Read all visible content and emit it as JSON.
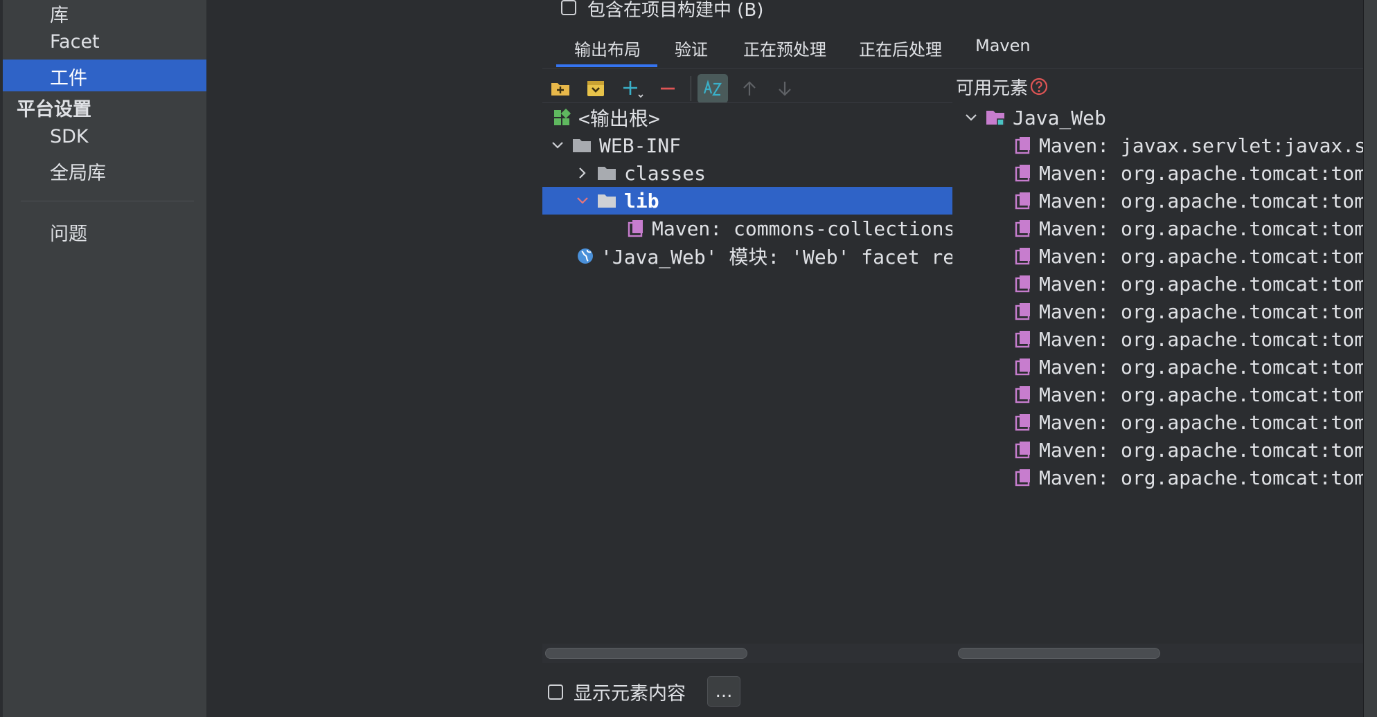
{
  "sidebar": {
    "items": [
      {
        "label": "库"
      },
      {
        "label": "Facet"
      },
      {
        "label": "工件",
        "selected": true
      }
    ],
    "platform_heading": "平台设置",
    "platform_items": [
      {
        "label": "SDK"
      },
      {
        "label": "全局库"
      }
    ],
    "problems": "问题"
  },
  "include_build_checkbox": {
    "label": "包含在项目构建中 (B)",
    "checked": false
  },
  "tabs": [
    {
      "label": "输出布局",
      "active": true
    },
    {
      "label": "验证"
    },
    {
      "label": "正在预处理"
    },
    {
      "label": "正在后处理"
    },
    {
      "label": "Maven"
    }
  ],
  "toolbar": {
    "icons": [
      "create-directory-icon",
      "create-archive-icon",
      "add-icon",
      "remove-icon",
      "sort-alphabetically-icon",
      "move-up-icon",
      "move-down-icon"
    ]
  },
  "output_tree": {
    "root": "<输出根>",
    "web_inf": "WEB-INF",
    "classes": "classes",
    "lib": "lib",
    "lib_child": "Maven: commons-collections",
    "facet_resource": "'Java_Web' 模块: 'Web' facet re"
  },
  "available": {
    "title": "可用元素",
    "module": "Java_Web",
    "items": [
      "Maven: javax.servlet:javax.s",
      "Maven: org.apache.tomcat:tom",
      "Maven: org.apache.tomcat:tom",
      "Maven: org.apache.tomcat:tom",
      "Maven: org.apache.tomcat:tom",
      "Maven: org.apache.tomcat:tom",
      "Maven: org.apache.tomcat:tom",
      "Maven: org.apache.tomcat:tom",
      "Maven: org.apache.tomcat:tom",
      "Maven: org.apache.tomcat:tom",
      "Maven: org.apache.tomcat:tom",
      "Maven: org.apache.tomcat:tom",
      "Maven: org.apache.tomcat:tom"
    ]
  },
  "show_content_checkbox": {
    "label": "显示元素内容",
    "checked": false
  },
  "more_button": "...",
  "colors": {
    "selection": "#2f63c7",
    "folder": "#a8abb0",
    "library": "#c77dce",
    "add": "#3ab0c8",
    "remove": "#e05555",
    "help": "#e05555"
  }
}
